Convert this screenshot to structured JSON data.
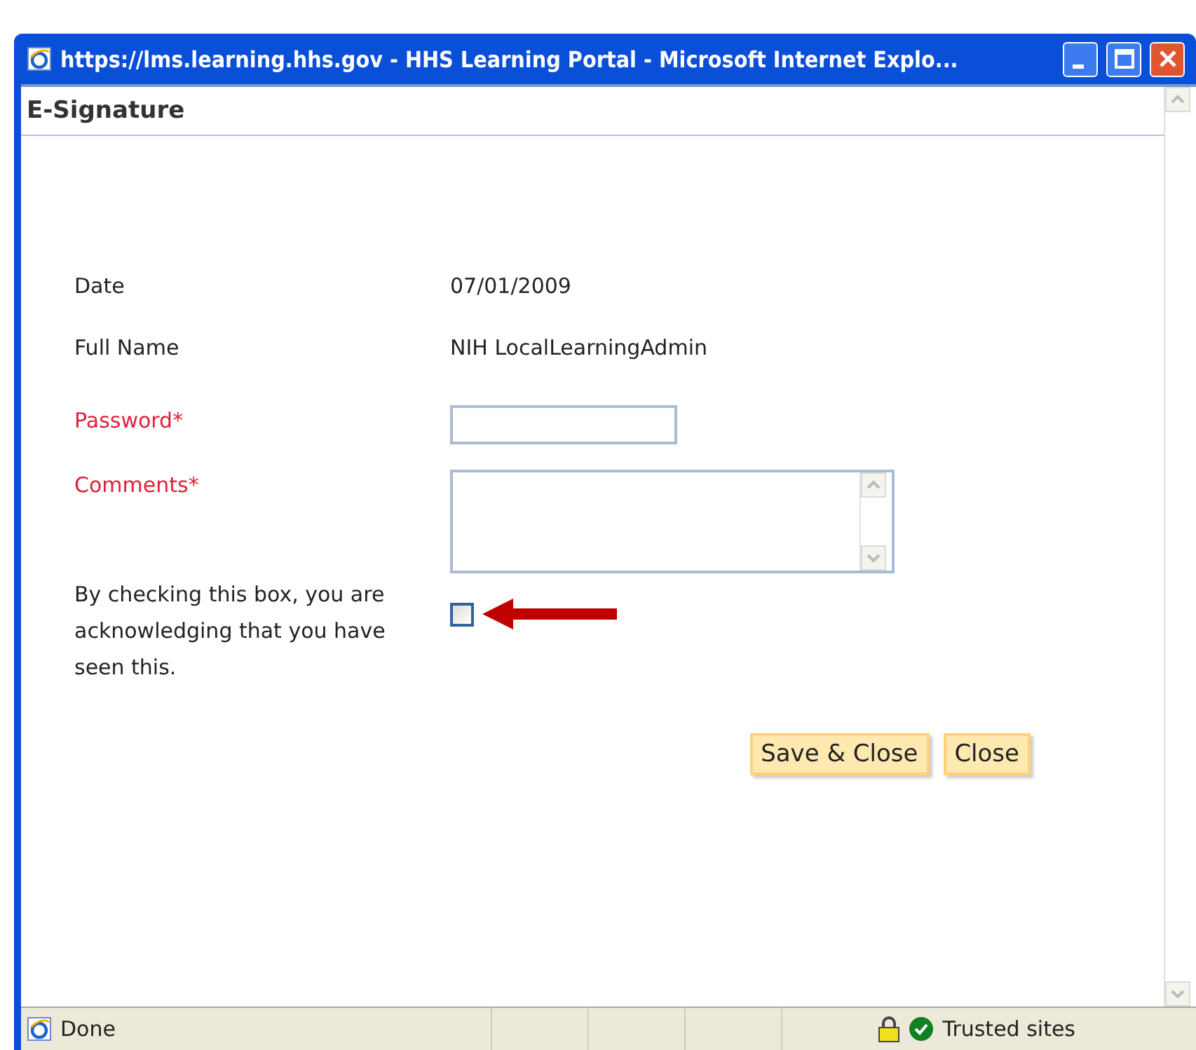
{
  "window": {
    "title": "https://lms.learning.hhs.gov - HHS Learning Portal - Microsoft Internet Explo..."
  },
  "dialog": {
    "title": "E-Signature"
  },
  "fields": [
    {
      "kind": "text",
      "label": "Date",
      "required": false,
      "value": "07/01/2009"
    },
    {
      "kind": "text",
      "label": "Full Name",
      "required": false,
      "value": "NIH LocalLearningAdmin"
    },
    {
      "kind": "input",
      "label": "Password",
      "required": true
    },
    {
      "kind": "textarea",
      "label": "Comments",
      "required": true
    },
    {
      "kind": "checkbox",
      "label": "By checking this box, you are acknowledging that you have seen this.",
      "required": false,
      "checked": false
    }
  ],
  "required_mark": "*",
  "buttons": [
    "Save & Close",
    "Close"
  ],
  "status_bar": {
    "text": "Done",
    "zone": "Trusted sites"
  }
}
